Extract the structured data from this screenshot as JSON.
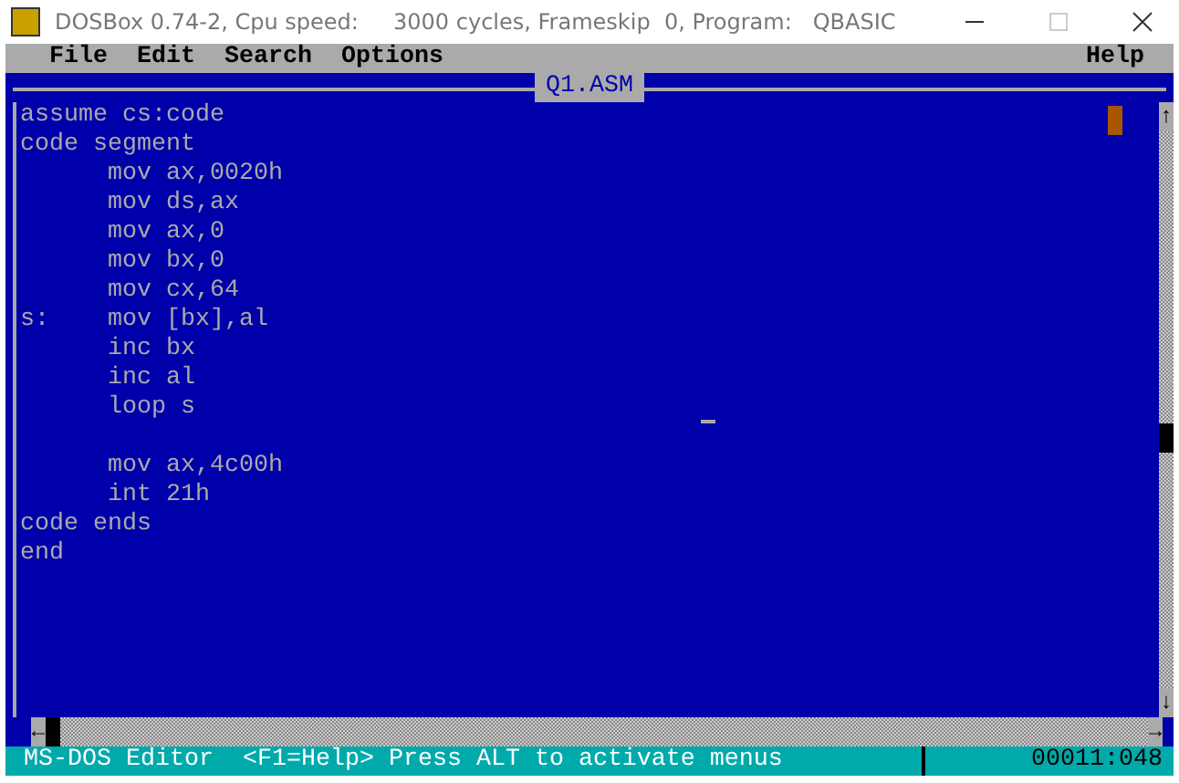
{
  "window": {
    "title": "DOSBox 0.74-2, Cpu speed:     3000 cycles, Frameskip  0, Program:   QBASIC"
  },
  "menu": {
    "items": [
      {
        "label": "File"
      },
      {
        "label": "Edit"
      },
      {
        "label": "Search"
      },
      {
        "label": "Options"
      }
    ],
    "help": "Help"
  },
  "editor": {
    "title": "Q1.ASM",
    "lines": [
      {
        "kind": "top",
        "text": "assume cs:code"
      },
      {
        "kind": "top",
        "text": "code segment"
      },
      {
        "kind": "body",
        "text": "mov ax,0020h"
      },
      {
        "kind": "body",
        "text": "mov ds,ax"
      },
      {
        "kind": "body",
        "text": "mov ax,0"
      },
      {
        "kind": "body",
        "text": "mov bx,0"
      },
      {
        "kind": "body",
        "text": "mov cx,64"
      },
      {
        "kind": "body",
        "label": "s:",
        "text": "mov [bx],al"
      },
      {
        "kind": "body",
        "text": "inc bx"
      },
      {
        "kind": "body",
        "text": "inc al"
      },
      {
        "kind": "body",
        "text": "loop s"
      },
      {
        "kind": "blank"
      },
      {
        "kind": "body",
        "text": "mov ax,4c00h"
      },
      {
        "kind": "body",
        "text": "int 21h"
      },
      {
        "kind": "top",
        "text": "code ends"
      },
      {
        "kind": "top",
        "text": "end"
      }
    ],
    "vscroll": {
      "up": "↑",
      "down": "↓"
    },
    "hscroll": {
      "left": "←",
      "right": "→"
    }
  },
  "status_bar": {
    "app": "MS-DOS Editor",
    "hint": "<F1=Help> Press ALT to activate menus",
    "position": "00011:048"
  }
}
